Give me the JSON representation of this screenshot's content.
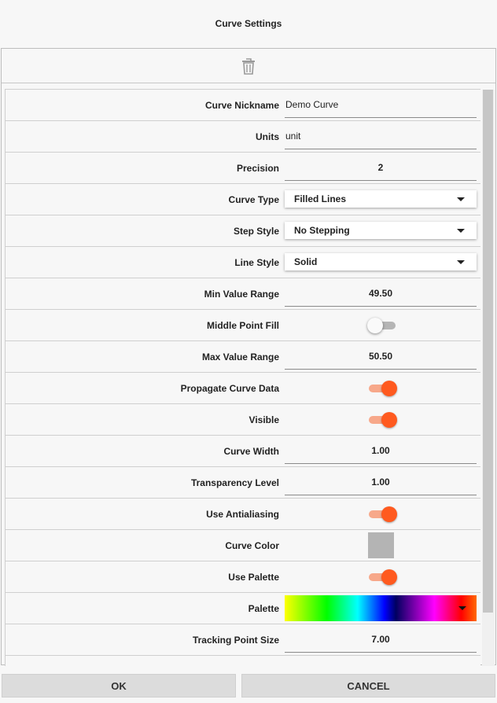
{
  "dialog": {
    "title": "Curve Settings"
  },
  "toolbar": {
    "delete_icon": "trash-icon"
  },
  "fields": {
    "curve_nickname": {
      "label": "Curve Nickname",
      "value": "Demo Curve"
    },
    "units": {
      "label": "Units",
      "value": "unit"
    },
    "precision": {
      "label": "Precision",
      "value": "2"
    },
    "curve_type": {
      "label": "Curve Type",
      "value": "Filled Lines"
    },
    "step_style": {
      "label": "Step Style",
      "value": "No Stepping"
    },
    "line_style": {
      "label": "Line Style",
      "value": "Solid"
    },
    "min_value_range": {
      "label": "Min Value Range",
      "value": "49.50"
    },
    "middle_point_fill": {
      "label": "Middle Point Fill",
      "on": false
    },
    "max_value_range": {
      "label": "Max Value Range",
      "value": "50.50"
    },
    "propagate_curve_data": {
      "label": "Propagate Curve Data",
      "on": true
    },
    "visible": {
      "label": "Visible",
      "on": true
    },
    "curve_width": {
      "label": "Curve Width",
      "value": "1.00"
    },
    "transparency_level": {
      "label": "Transparency Level",
      "value": "1.00"
    },
    "use_antialiasing": {
      "label": "Use Antialiasing",
      "on": true
    },
    "curve_color": {
      "label": "Curve Color",
      "color": "#b4b4b4"
    },
    "use_palette": {
      "label": "Use Palette",
      "on": true
    },
    "palette": {
      "label": "Palette"
    },
    "tracking_point_size": {
      "label": "Tracking Point Size",
      "value": "7.00"
    }
  },
  "colors": {
    "accent": "#ff5a1f",
    "accent_track": "#f7a88a"
  },
  "buttons": {
    "ok": "OK",
    "cancel": "CANCEL"
  }
}
